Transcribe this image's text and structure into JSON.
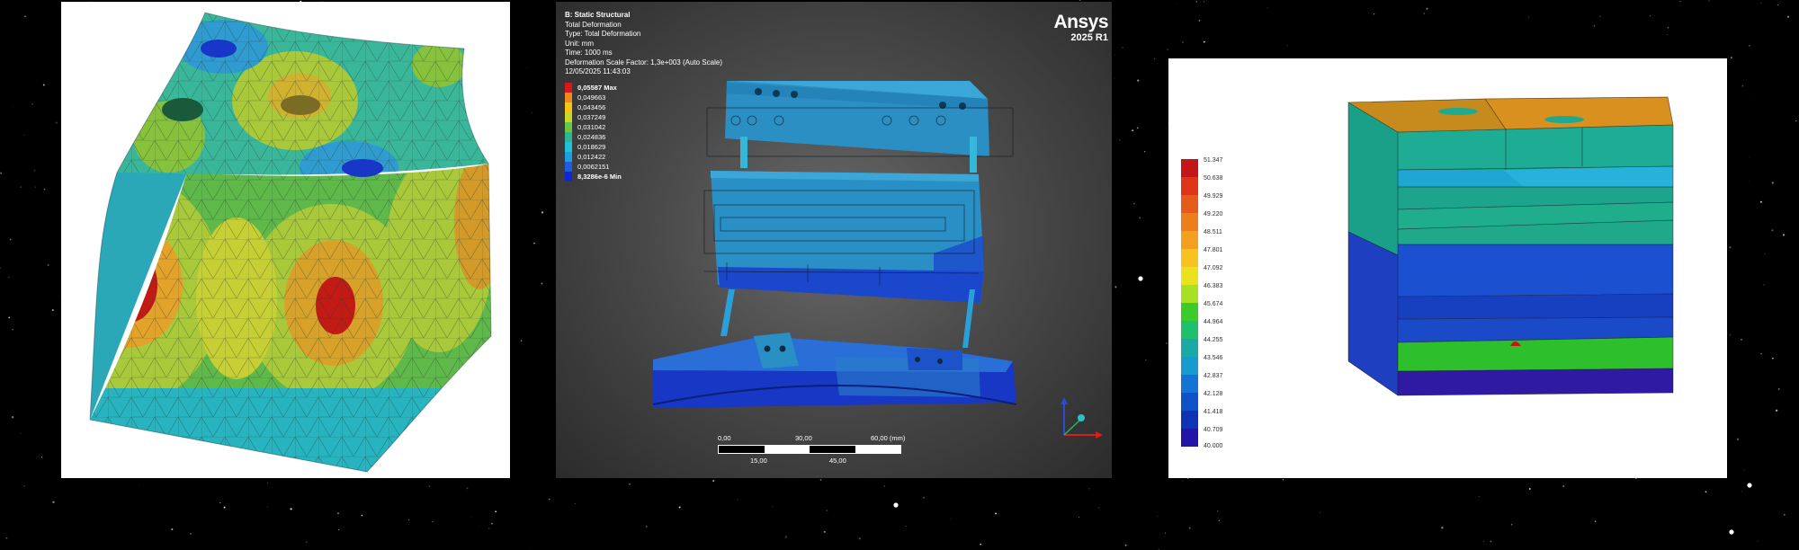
{
  "ansys": {
    "title": "B: Static Structural",
    "lines": [
      "Total Deformation",
      "Type: Total Deformation",
      "Unit: mm",
      "Time: 1000 ms",
      "Deformation Scale Factor: 1,3e+003 (Auto Scale)",
      "12/05/2025 11:43:03"
    ],
    "brand": "Ansys",
    "version": "2025 R1",
    "legend": {
      "max_label": "0,05587 Max",
      "min_label": "8,3286e-6 Min",
      "values": [
        "0,049663",
        "0,043456",
        "0,037249",
        "0,031042",
        "0,024836",
        "0,018629",
        "0,012422",
        "0,0062151"
      ],
      "colors": [
        "#d7191c",
        "#f08a1c",
        "#f6c31d",
        "#c8d82a",
        "#6ac646",
        "#2fb596",
        "#22c2d6",
        "#1ea0e0",
        "#1d5ee0",
        "#1024d8"
      ]
    },
    "scale": {
      "top": [
        "0,00",
        "30,00",
        "60,00 (mm)"
      ],
      "bottom": [
        "15,00",
        "45,00"
      ]
    }
  },
  "thermal": {
    "legend": {
      "values": [
        "51.347",
        "50.638",
        "49.929",
        "49.220",
        "48.511",
        "47.801",
        "47.092",
        "46.383",
        "45.674",
        "44.964",
        "44.255",
        "43.546",
        "42.837",
        "42.128",
        "41.418",
        "40.709",
        "40.000"
      ],
      "colors": [
        "#c41616",
        "#de3519",
        "#e55c1a",
        "#ec7f1c",
        "#f2a11e",
        "#f6c320",
        "#e8e21f",
        "#a8e025",
        "#3ccc2a",
        "#1fbf6e",
        "#1aa9a6",
        "#1899cf",
        "#1473d4",
        "#1151c8",
        "#0e33b4",
        "#2313a6"
      ]
    }
  }
}
